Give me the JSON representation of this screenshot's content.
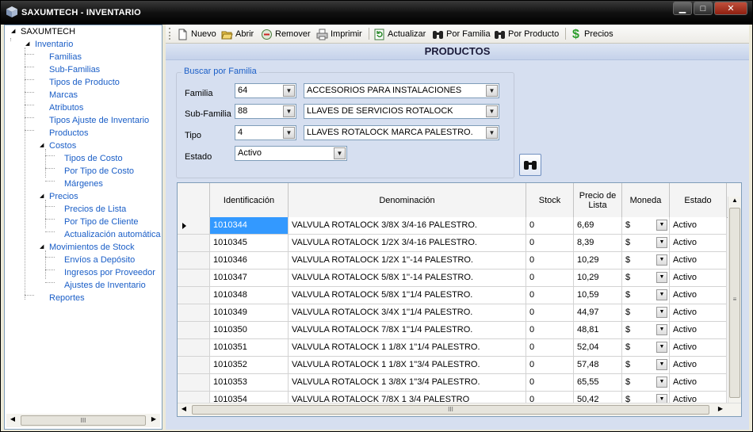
{
  "window": {
    "title": "SAXUMTECH - INVENTARIO",
    "minimize": "▁",
    "maximize": "□",
    "close": "✕"
  },
  "tree": {
    "root": "SAXUMTECH",
    "inventario": "Inventario",
    "items": {
      "familias": "Familias",
      "subfamilias": "Sub-Familias",
      "tipos_producto": "Tipos de Producto",
      "marcas": "Marcas",
      "atributos": "Atributos",
      "tipos_ajuste": "Tipos Ajuste de Inventario",
      "productos": "Productos",
      "costos": "Costos",
      "tipos_costo": "Tipos de Costo",
      "por_tipo_costo": "Por Tipo de Costo",
      "margenes": "Márgenes",
      "precios": "Precios",
      "precios_lista": "Precios de Lista",
      "por_tipo_cliente": "Por Tipo de Cliente",
      "actualizacion": "Actualización automática",
      "movimientos": "Movimientos de Stock",
      "envios": "Envíos a Depósito",
      "ingresos": "Ingresos por Proveedor",
      "ajustes": "Ajustes de Inventario",
      "reportes": "Reportes"
    },
    "scroll_thumb": "III"
  },
  "toolbar": {
    "nuevo": "Nuevo",
    "abrir": "Abrir",
    "remover": "Remover",
    "imprimir": "Imprimir",
    "actualizar": "Actualizar",
    "por_familia": "Por Familia",
    "por_producto": "Por Producto",
    "precios": "Precios"
  },
  "header": {
    "title": "PRODUCTOS"
  },
  "search": {
    "group_title": "Buscar por Familia",
    "familia_label": "Familia",
    "familia_code": "64",
    "familia_name": "ACCESORIOS PARA INSTALACIONES",
    "subfamilia_label": "Sub-Familia",
    "subfamilia_code": "88",
    "subfamilia_name": "LLAVES DE SERVICIOS ROTALOCK",
    "tipo_label": "Tipo",
    "tipo_code": "4",
    "tipo_name": "LLAVES ROTALOCK MARCA PALESTRO.",
    "estado_label": "Estado",
    "estado_value": "Activo"
  },
  "grid": {
    "columns": [
      "Identificación",
      "Denominación",
      "Stock",
      "Precio de Lista",
      "Moneda",
      "Estado"
    ],
    "rows": [
      {
        "id": "1010344",
        "denominacion": "VALVULA ROTALOCK 3/8X 3/4-16 PALESTRO.",
        "stock": "0",
        "precio": "6,69",
        "moneda": "$",
        "estado": "Activo"
      },
      {
        "id": "1010345",
        "denominacion": "VALVULA ROTALOCK 1/2X 3/4-16 PALESTRO.",
        "stock": "0",
        "precio": "8,39",
        "moneda": "$",
        "estado": "Activo"
      },
      {
        "id": "1010346",
        "denominacion": "VALVULA ROTALOCK 1/2X 1''-14 PALESTRO.",
        "stock": "0",
        "precio": "10,29",
        "moneda": "$",
        "estado": "Activo"
      },
      {
        "id": "1010347",
        "denominacion": "VALVULA ROTALOCK 5/8X 1''-14 PALESTRO.",
        "stock": "0",
        "precio": "10,29",
        "moneda": "$",
        "estado": "Activo"
      },
      {
        "id": "1010348",
        "denominacion": "VALVULA ROTALOCK 5/8X 1''1/4 PALESTRO.",
        "stock": "0",
        "precio": "10,59",
        "moneda": "$",
        "estado": "Activo"
      },
      {
        "id": "1010349",
        "denominacion": "VALVULA ROTALOCK 3/4X 1''1/4 PALESTRO.",
        "stock": "0",
        "precio": "44,97",
        "moneda": "$",
        "estado": "Activo"
      },
      {
        "id": "1010350",
        "denominacion": "VALVULA ROTALOCK 7/8X 1''1/4 PALESTRO.",
        "stock": "0",
        "precio": "48,81",
        "moneda": "$",
        "estado": "Activo"
      },
      {
        "id": "1010351",
        "denominacion": "VALVULA ROTALOCK 1 1/8X 1''1/4 PALESTRO.",
        "stock": "0",
        "precio": "52,04",
        "moneda": "$",
        "estado": "Activo"
      },
      {
        "id": "1010352",
        "denominacion": "VALVULA ROTALOCK 1 1/8X 1''3/4 PALESTRO.",
        "stock": "0",
        "precio": "57,48",
        "moneda": "$",
        "estado": "Activo"
      },
      {
        "id": "1010353",
        "denominacion": "VALVULA ROTALOCK 1 3/8X 1''3/4 PALESTRO.",
        "stock": "0",
        "precio": "65,55",
        "moneda": "$",
        "estado": "Activo"
      },
      {
        "id": "1010354",
        "denominacion": "VALVULA ROTALOCK 7/8X 1 3/4 PALESTRO",
        "stock": "0",
        "precio": "50,42",
        "moneda": "$",
        "estado": "Activo"
      }
    ],
    "scroll_thumb": "III",
    "vscroll_thumb": "≡"
  },
  "colors": {
    "accent": "#1a5ec7",
    "selection": "#3399ff",
    "money_icon": "#2a9d2a"
  }
}
